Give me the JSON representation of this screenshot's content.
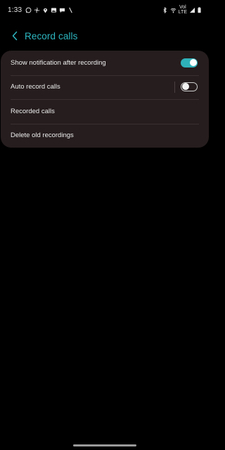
{
  "status_bar": {
    "time": "1:33",
    "battery_label": "Vol\nLTE",
    "icons_left": [
      "whatsapp-icon",
      "fan-icon",
      "location-icon",
      "gallery-icon",
      "chat-icon",
      "slash-icon"
    ],
    "icons_right": [
      "bluetooth-icon",
      "wifi-icon",
      "signal-icon",
      "battery-icon"
    ]
  },
  "header": {
    "title": "Record calls",
    "accent_color": "#2db7c1"
  },
  "settings": {
    "items": [
      {
        "label": "Show notification after recording",
        "control": "toggle",
        "state": "on"
      },
      {
        "label": "Auto record calls",
        "control": "toggle",
        "state": "off"
      },
      {
        "label": "Recorded calls",
        "control": "none"
      },
      {
        "label": "Delete old recordings",
        "control": "none"
      }
    ]
  },
  "colors": {
    "background": "#000000",
    "card": "#261d1e",
    "toggle_on": "#2fb1b9"
  }
}
